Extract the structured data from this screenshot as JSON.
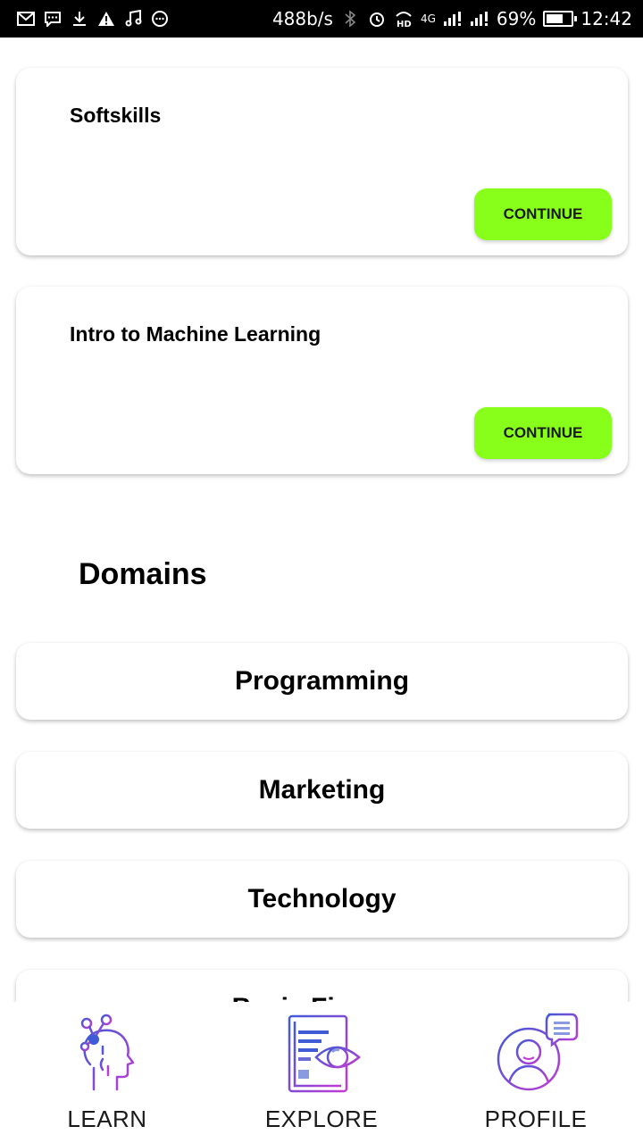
{
  "status_bar": {
    "speed": "488b/s",
    "network": "4G",
    "battery_percent": "69%",
    "battery_level": 0.69,
    "time": "12:42",
    "icons": [
      "gmail-icon",
      "message-icon",
      "download-icon",
      "warning-icon",
      "music-icon",
      "more-icon",
      "bluetooth-icon",
      "alarm-icon",
      "hd-icon",
      "signal-icon",
      "signal-icon",
      "battery-icon"
    ]
  },
  "courses": [
    {
      "title": "Softskills",
      "button_label": "CONTINUE"
    },
    {
      "title": "Intro to Machine Learning",
      "button_label": "CONTINUE"
    }
  ],
  "domains": {
    "title": "Domains",
    "items": [
      "Programming",
      "Marketing",
      "Technology",
      "Basic Finance"
    ]
  },
  "bottom_nav": {
    "items": [
      {
        "label": "LEARN",
        "icon": "learn-head-icon"
      },
      {
        "label": "EXPLORE",
        "icon": "explore-book-eye-icon"
      },
      {
        "label": "PROFILE",
        "icon": "profile-avatar-icon"
      }
    ]
  },
  "colors": {
    "accent": "#88ff1a",
    "icon_gradient_start": "#3f5bd6",
    "icon_gradient_end": "#c23bd4"
  }
}
